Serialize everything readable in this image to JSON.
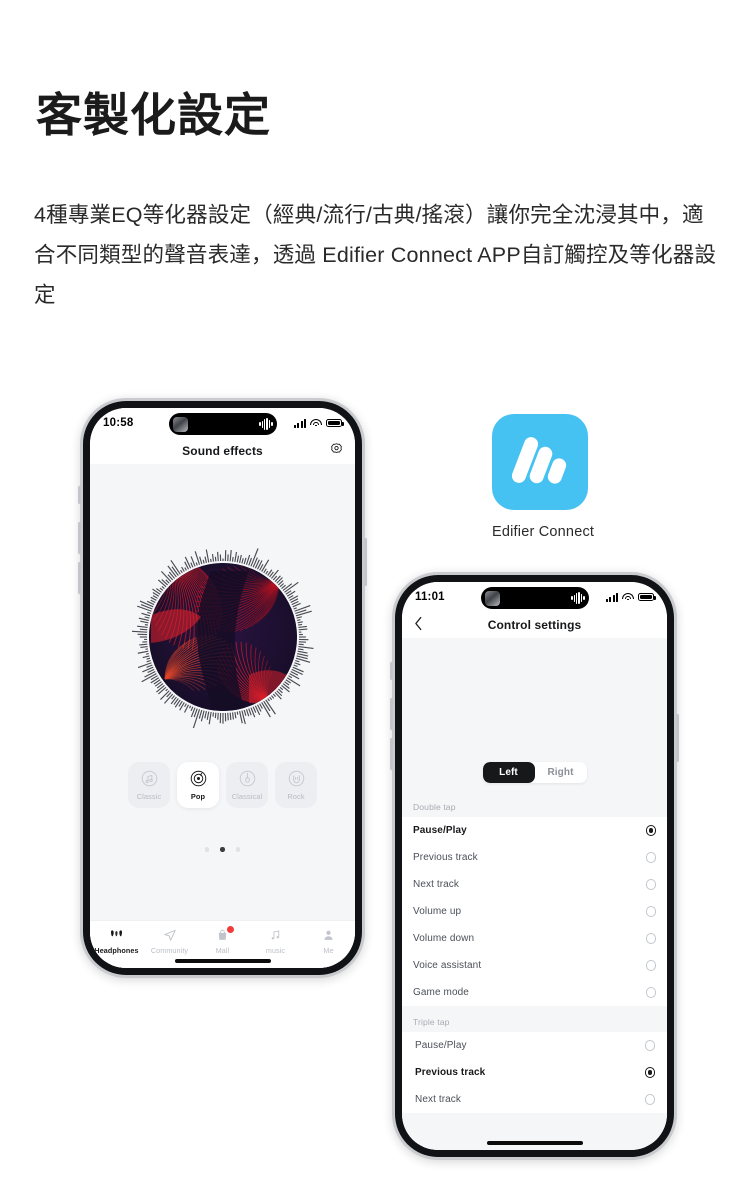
{
  "headline": "客製化設定",
  "body_text": "4種專業EQ等化器設定（經典/流行/古典/搖滾）讓你完全沈浸其中，適合不同類型的聲音表達，透過 Edifier Connect APP自訂觸控及等化器設定",
  "app": {
    "icon_name": "edifier-logo-icon",
    "label": "Edifier Connect",
    "brand_color": "#45c1f2"
  },
  "phone1": {
    "status_bar": {
      "time": "10:58",
      "signal_icon": "cellular-signal-icon",
      "wifi_icon": "wifi-icon",
      "battery_icon": "battery-icon",
      "island_waveform_icon": "audio-waveform-icon"
    },
    "nav": {
      "title": "Sound effects",
      "settings_icon": "gear-icon"
    },
    "visualizer": {
      "name": "album-art-visualizer",
      "ring_icon": "audio-spectrum-ring-icon"
    },
    "eq_presets": [
      {
        "label": "Classic",
        "icon": "music-note-icon",
        "selected": false
      },
      {
        "label": "Pop",
        "icon": "vinyl-record-icon",
        "selected": true
      },
      {
        "label": "Classical",
        "icon": "violin-icon",
        "selected": false
      },
      {
        "label": "Rock",
        "icon": "rock-hand-icon",
        "selected": false
      }
    ],
    "pager": {
      "count": 3,
      "active_index": 1
    },
    "tabs": [
      {
        "label": "Headphones",
        "icon": "earbuds-icon",
        "active": true,
        "badge": false
      },
      {
        "label": "Community",
        "icon": "send-icon",
        "active": false,
        "badge": false
      },
      {
        "label": "Mall",
        "icon": "shopping-bag-icon",
        "active": false,
        "badge": true
      },
      {
        "label": "music",
        "icon": "music-note-icon",
        "active": false,
        "badge": false
      },
      {
        "label": "Me",
        "icon": "person-icon",
        "active": false,
        "badge": false
      }
    ]
  },
  "phone2": {
    "status_bar": {
      "time": "11:01",
      "signal_icon": "cellular-signal-icon",
      "wifi_icon": "wifi-icon",
      "battery_icon": "battery-icon",
      "island_waveform_icon": "audio-waveform-icon"
    },
    "nav": {
      "back_icon": "chevron-left-icon",
      "title": "Control settings"
    },
    "earbud_segment": {
      "options": [
        "Left",
        "Right"
      ],
      "selected": "Left"
    },
    "sections": [
      {
        "header": "Double tap",
        "options": [
          {
            "label": "Pause/Play",
            "selected": true
          },
          {
            "label": "Previous track",
            "selected": false
          },
          {
            "label": "Next track",
            "selected": false
          },
          {
            "label": "Volume up",
            "selected": false
          },
          {
            "label": "Volume down",
            "selected": false
          },
          {
            "label": "Voice assistant",
            "selected": false
          },
          {
            "label": "Game mode",
            "selected": false
          }
        ]
      },
      {
        "header": "Triple tap",
        "options": [
          {
            "label": "Pause/Play",
            "selected": false
          },
          {
            "label": "Previous track",
            "selected": true
          },
          {
            "label": "Next track",
            "selected": false
          }
        ]
      }
    ]
  }
}
